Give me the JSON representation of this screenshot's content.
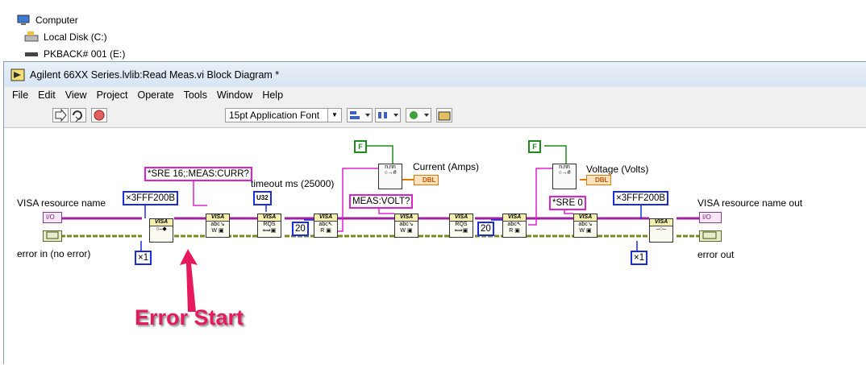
{
  "explorer": {
    "items": [
      {
        "label": "Computer",
        "icon": "computer-icon"
      },
      {
        "label": "Local Disk (C:)",
        "icon": "disk-icon"
      },
      {
        "label": "PKBACK# 001 (E:)",
        "icon": "drive-icon"
      }
    ]
  },
  "window": {
    "title": "Agilent 66XX Series.lvlib:Read Meas.vi Block Diagram *"
  },
  "menu": [
    "File",
    "Edit",
    "View",
    "Project",
    "Operate",
    "Tools",
    "Window",
    "Help"
  ],
  "toolbar": {
    "font": "15pt Application Font"
  },
  "diagram": {
    "labels": {
      "visa_in": "VISA resource name",
      "error_in": "error in (no error)",
      "timeout": "timeout ms (25000)",
      "current": "Current (Amps)",
      "voltage": "Voltage (Volts)",
      "visa_out": "VISA resource name out",
      "error_out": "error out"
    },
    "constants": {
      "hex1": "×3FFF200B",
      "hex2": "×3FFF200B",
      "sre16": "*SRE 16;:MEAS:CURR?",
      "measvolt": "MEAS:VOLT?",
      "sre0": "*SRE 0",
      "one1": "×1",
      "one2": "×1",
      "twenty1": "20",
      "twenty2": "20",
      "u32": "U32",
      "f1": "F",
      "f2": "F",
      "dbl": "DBL",
      "io": "I/O"
    },
    "annotation": "Error Start"
  },
  "colors": {
    "visa_wire": "#a020a0",
    "error_wire": "#7a8a20",
    "numeric": "#1a2be0",
    "string": "#e020d0",
    "boolean": "#1e8a1e",
    "annotation": "#e8185e"
  }
}
